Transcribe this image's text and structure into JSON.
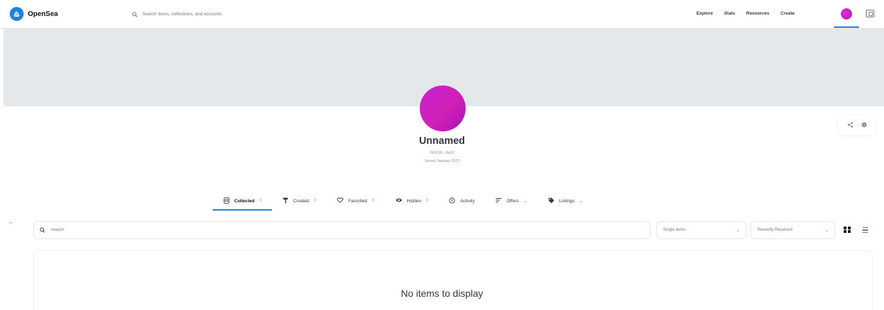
{
  "colors": {
    "accent": "#2081e2",
    "banner": "#e5e8eb",
    "avatar": "#c524d0"
  },
  "nav": {
    "logo_text": "OpenSea",
    "logo_icon": "opensea-sailboat-icon",
    "search_placeholder": "Search items, collections, and accounts",
    "links": [
      "Explore",
      "Stats",
      "Resources",
      "Create"
    ],
    "wallet_icon": "wallet-icon"
  },
  "profile": {
    "name": "Unnamed",
    "address": "0x2c1b...6a18",
    "joined": "Joined January 2022"
  },
  "tabs": [
    {
      "label": "Collected",
      "count": "0",
      "icon": "collected-icon"
    },
    {
      "label": "Created",
      "count": "0",
      "icon": "paintbrush-icon"
    },
    {
      "label": "Favorited",
      "count": "0",
      "icon": "heart-icon"
    },
    {
      "label": "Hidden",
      "count": "0",
      "icon": "eye-slash-icon"
    },
    {
      "label": "Activity",
      "icon": "activity-icon"
    },
    {
      "label": "Offers",
      "icon": "offers-icon"
    },
    {
      "label": "Listings",
      "icon": "tag-icon"
    }
  ],
  "filters": {
    "search_placeholder": "Search",
    "items_select": "Single items",
    "sort_select": "Recently Received"
  },
  "empty_state": "No items to display"
}
